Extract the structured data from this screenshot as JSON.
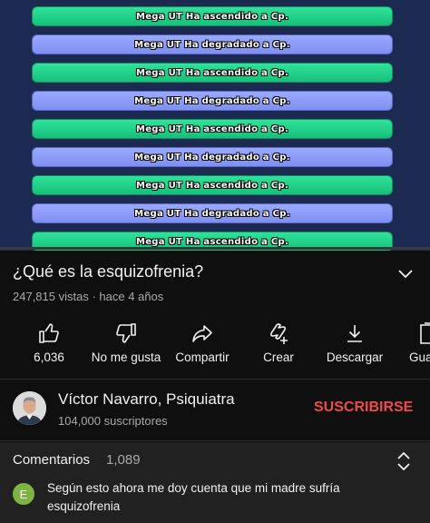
{
  "video": {
    "banners": [
      {
        "text": "Mega UT Ha ascendido a Cp.",
        "type": "up"
      },
      {
        "text": "Mega UT Ha degradado a Cp.",
        "type": "down"
      },
      {
        "text": "Mega UT Ha ascendido a Cp.",
        "type": "up"
      },
      {
        "text": "Mega UT Ha degradado a Cp.",
        "type": "down"
      },
      {
        "text": "Mega UT Ha ascendido a Cp.",
        "type": "up"
      },
      {
        "text": "Mega UT Ha degradado a Cp.",
        "type": "down"
      },
      {
        "text": "Mega UT Ha ascendido a Cp.",
        "type": "up"
      },
      {
        "text": "Mega UT Ha degradado a Cp.",
        "type": "down"
      },
      {
        "text": "Mega UT Ha ascendido a Cp.",
        "type": "up"
      }
    ],
    "progress_fraction": 0.0,
    "colors": {
      "up": "#22d388",
      "down": "#8c9cf8",
      "background": "#1c2a52"
    }
  },
  "title": "¿Qué es la esquizofrenia?",
  "meta": "247,815 vistas · hace 4 años",
  "actions": [
    {
      "label": "6,036",
      "icon": "thumbs-up-icon"
    },
    {
      "label": "No me gusta",
      "icon": "thumbs-down-icon"
    },
    {
      "label": "Compartir",
      "icon": "share-icon"
    },
    {
      "label": "Crear",
      "icon": "create-icon"
    },
    {
      "label": "Descargar",
      "icon": "download-icon"
    },
    {
      "label": "Gua",
      "icon": "save-icon"
    }
  ],
  "channel": {
    "name": "Víctor Navarro, Psiquiatra",
    "subscribers": "104,000 suscriptores",
    "subscribe_label": "SUSCRIBIRSE",
    "subscribe_color": "#f04a47"
  },
  "comments": {
    "title": "Comentarios",
    "count": "1,089",
    "first": {
      "avatar_letter": "E",
      "avatar_color": "#7cb342",
      "text": "Según esto ahora me doy cuenta que mi madre sufría esquizofrenia"
    }
  }
}
